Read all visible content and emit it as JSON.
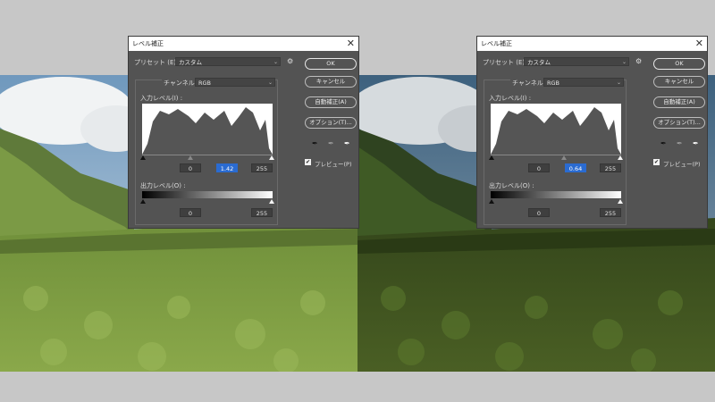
{
  "dialog_title": "レベル補正",
  "preset": {
    "label": "プリセット (E) :",
    "value": "カスタム"
  },
  "channel": {
    "label": "チャンネル :",
    "value": "RGB"
  },
  "input_levels_label": "入力レベル(I) :",
  "output_levels_label": "出力レベル(O) :",
  "buttons": {
    "ok": "OK",
    "cancel": "キャンセル",
    "auto": "自動補正(A)",
    "options": "オプション(T)..."
  },
  "preview_label": "プレビュー(P)",
  "preview_checked": true,
  "left_dialog": {
    "input_black": "0",
    "input_gamma": "1.42",
    "input_white": "255",
    "output_black": "0",
    "output_white": "255"
  },
  "right_dialog": {
    "input_black": "0",
    "input_gamma": "0.64",
    "input_white": "255",
    "output_black": "0",
    "output_white": "255"
  },
  "colors": {
    "dialog_bg": "#535353",
    "field_active": "#2a6bd1",
    "titlebar": "#ffffff"
  },
  "icons": {
    "close": "close-icon",
    "gear": "gear-icon",
    "eyedropper": "eyedropper-icon",
    "check": "checkmark-icon"
  }
}
